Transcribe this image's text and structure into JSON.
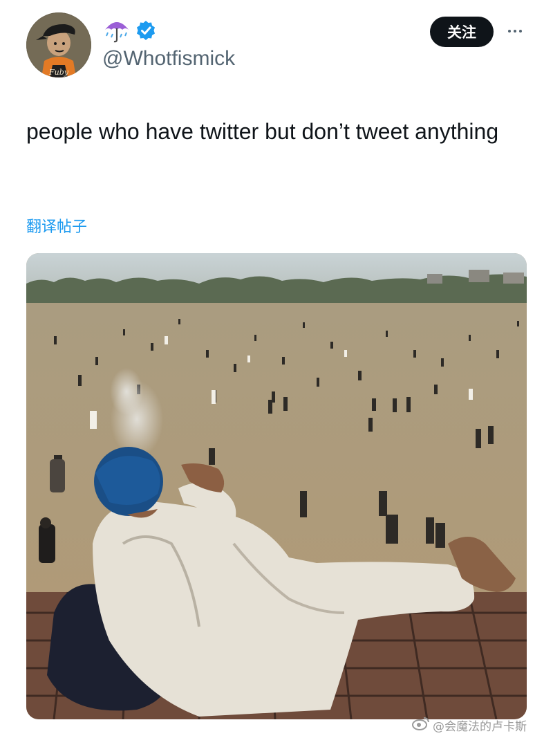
{
  "user": {
    "display_name_emoji": "☔",
    "handle": "@Whotfismick",
    "verified": true,
    "avatar_icon": "cartoon-avatar-icon"
  },
  "actions": {
    "follow_label": "关注",
    "more_icon": "more-dots-icon"
  },
  "tweet": {
    "text": "people who have twitter but don’t tweet anything",
    "translate_label": "翻译帖子"
  },
  "media": {
    "icon": "photo-man-reclining-field"
  },
  "watermark": {
    "text": "@会魔法的卢卡斯"
  },
  "colors": {
    "verified": "#1d9bf0",
    "link": "#1d9bf0",
    "follow_bg": "#0f1419"
  }
}
